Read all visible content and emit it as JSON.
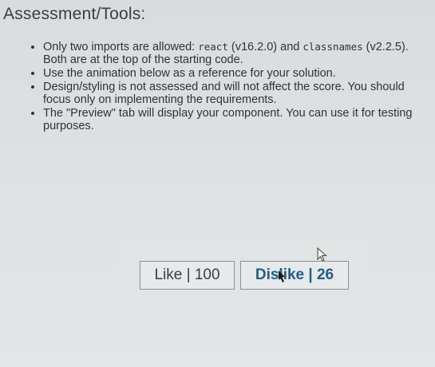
{
  "header": {
    "title": "Assessment/Tools:"
  },
  "requirements": [
    {
      "before": "Only two imports are allowed: ",
      "code1": "react",
      "middle": " (v16.2.0) and ",
      "code2": "classnames",
      "after": " (v2.2.5). Both are at the top of the starting code."
    },
    {
      "text": "Use the animation below as a reference for your solution."
    },
    {
      "text": "Design/styling is not assessed and will not affect the score. You should focus only on implementing the requirements."
    },
    {
      "text": "The \"Preview\" tab will display your component. You can use it for testing purposes."
    }
  ],
  "preview": {
    "like_label": "Like | 100",
    "dislike_label": "Dislike | 26",
    "dislike_active": true
  },
  "colors": {
    "active_text": "#1f5f86",
    "button_border": "#8d9296"
  },
  "icons": [
    "arrow-cursor-icon",
    "text-cursor-icon"
  ]
}
